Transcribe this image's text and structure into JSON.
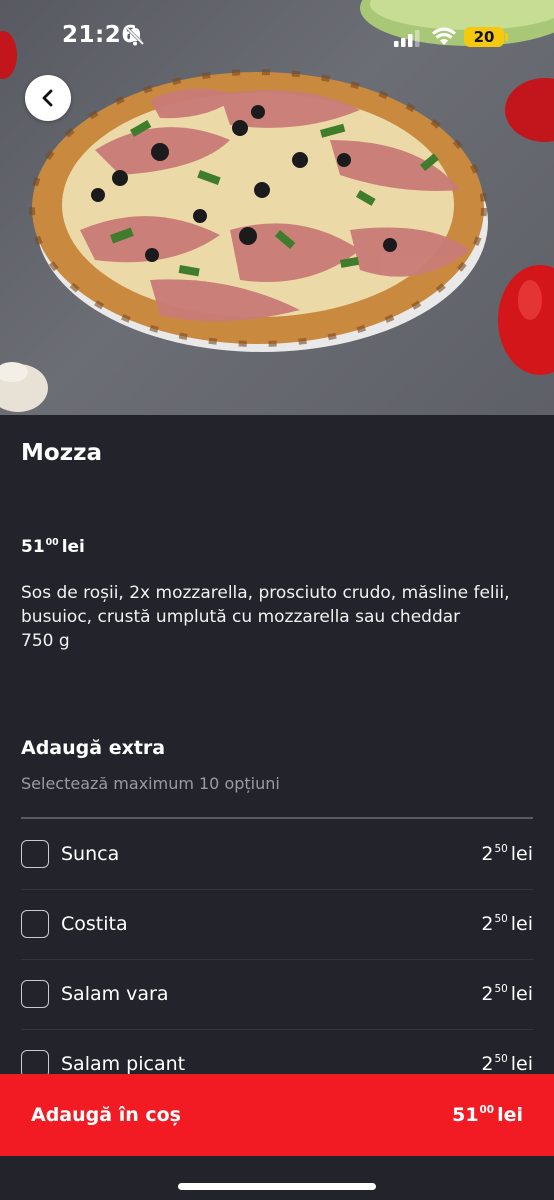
{
  "status_bar": {
    "time": "21:26",
    "battery": "20"
  },
  "product": {
    "name": "Mozza",
    "price_main": "51",
    "price_cents": "00",
    "currency": "lei",
    "description": "Sos de roșii, 2x mozzarella, prosciuto crudo, măsline felii, busuioc, crustă umplută cu mozzarella sau cheddar",
    "weight": "750 g"
  },
  "extras": {
    "title": "Adaugă extra",
    "subtitle": "Selectează maximum 10 opțiuni",
    "options": [
      {
        "label": "Sunca",
        "price_main": "2",
        "price_cents": "50",
        "currency": "lei"
      },
      {
        "label": "Costita",
        "price_main": "2",
        "price_cents": "50",
        "currency": "lei"
      },
      {
        "label": "Salam vara",
        "price_main": "2",
        "price_cents": "50",
        "currency": "lei"
      },
      {
        "label": "Salam picant",
        "price_main": "2",
        "price_cents": "50",
        "currency": "lei"
      }
    ]
  },
  "cta": {
    "label": "Adaugă în coș",
    "price_main": "51",
    "price_cents": "00",
    "currency": "lei"
  },
  "colors": {
    "accent": "#f31b23",
    "background": "#23242b",
    "battery": "#f6c90e"
  }
}
